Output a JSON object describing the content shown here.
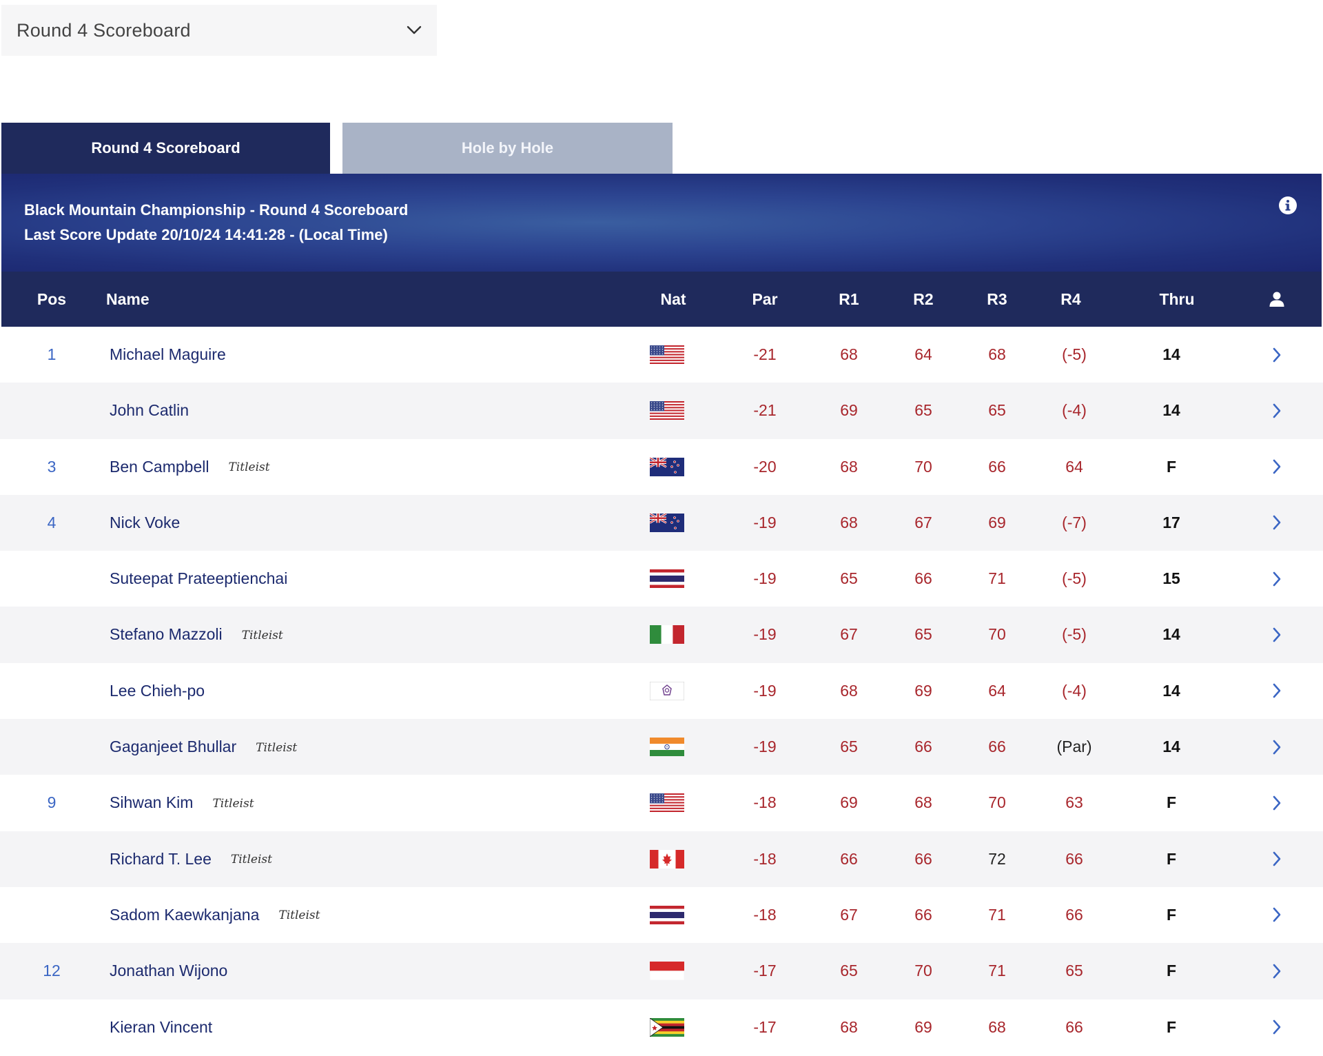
{
  "dropdown": {
    "selected": "Round 4 Scoreboard"
  },
  "tabs": [
    {
      "label": "Round 4 Scoreboard",
      "active": true
    },
    {
      "label": "Hole by Hole",
      "active": false
    }
  ],
  "banner": {
    "title": "Black Mountain Championship - Round 4 Scoreboard",
    "update": "Last Score Update 20/10/24 14:41:28 - (Local Time)"
  },
  "columns": {
    "pos": "Pos",
    "name": "Name",
    "nat": "Nat",
    "par": "Par",
    "r1": "R1",
    "r2": "R2",
    "r3": "R3",
    "r4": "R4",
    "thru": "Thru",
    "profile_icon": "person-icon"
  },
  "colors": {
    "header_bg": "#1f2a5c",
    "tab_inactive": "#a9b3c6",
    "score_red": "#a8262c",
    "pos_blue": "#3b66c4",
    "name_navy": "#1c2a6e",
    "row_alt": "#f4f4f6"
  },
  "rows": [
    {
      "pos": "1",
      "name": "Michael Maguire",
      "sponsor": "",
      "flag": "usa",
      "par": "-21",
      "r1": "68",
      "r2": "64",
      "r3": "68",
      "r4": "(-5)",
      "thru": "14"
    },
    {
      "pos": "",
      "name": "John Catlin",
      "sponsor": "",
      "flag": "usa",
      "par": "-21",
      "r1": "69",
      "r2": "65",
      "r3": "65",
      "r4": "(-4)",
      "thru": "14"
    },
    {
      "pos": "3",
      "name": "Ben Campbell",
      "sponsor": "Titleist",
      "flag": "nzl",
      "par": "-20",
      "r1": "68",
      "r2": "70",
      "r3": "66",
      "r4": "64",
      "thru": "F"
    },
    {
      "pos": "4",
      "name": "Nick Voke",
      "sponsor": "",
      "flag": "nzl",
      "par": "-19",
      "r1": "68",
      "r2": "67",
      "r3": "69",
      "r4": "(-7)",
      "thru": "17"
    },
    {
      "pos": "",
      "name": "Suteepat Prateeptienchai",
      "sponsor": "",
      "flag": "tha",
      "par": "-19",
      "r1": "65",
      "r2": "66",
      "r3": "71",
      "r4": "(-5)",
      "thru": "15"
    },
    {
      "pos": "",
      "name": "Stefano Mazzoli",
      "sponsor": "Titleist",
      "flag": "ita",
      "par": "-19",
      "r1": "67",
      "r2": "65",
      "r3": "70",
      "r4": "(-5)",
      "thru": "14"
    },
    {
      "pos": "",
      "name": "Lee Chieh-po",
      "sponsor": "",
      "flag": "tpe",
      "par": "-19",
      "r1": "68",
      "r2": "69",
      "r3": "64",
      "r4": "(-4)",
      "thru": "14"
    },
    {
      "pos": "",
      "name": "Gaganjeet Bhullar",
      "sponsor": "Titleist",
      "flag": "ind",
      "par": "-19",
      "r1": "65",
      "r2": "66",
      "r3": "66",
      "r4": "(Par)",
      "thru": "14",
      "r4_even": true
    },
    {
      "pos": "9",
      "name": "Sihwan Kim",
      "sponsor": "Titleist",
      "flag": "usa",
      "par": "-18",
      "r1": "69",
      "r2": "68",
      "r3": "70",
      "r4": "63",
      "thru": "F"
    },
    {
      "pos": "",
      "name": "Richard T. Lee",
      "sponsor": "Titleist",
      "flag": "can",
      "par": "-18",
      "r1": "66",
      "r2": "66",
      "r3": "72",
      "r4": "66",
      "thru": "F",
      "r3_even": true
    },
    {
      "pos": "",
      "name": "Sadom Kaewkanjana",
      "sponsor": "Titleist",
      "flag": "tha",
      "par": "-18",
      "r1": "67",
      "r2": "66",
      "r3": "71",
      "r4": "66",
      "thru": "F"
    },
    {
      "pos": "12",
      "name": "Jonathan Wijono",
      "sponsor": "",
      "flag": "idn",
      "par": "-17",
      "r1": "65",
      "r2": "70",
      "r3": "71",
      "r4": "65",
      "thru": "F"
    },
    {
      "pos": "",
      "name": "Kieran Vincent",
      "sponsor": "",
      "flag": "zim",
      "par": "-17",
      "r1": "68",
      "r2": "69",
      "r3": "68",
      "r4": "66",
      "thru": "F"
    }
  ]
}
